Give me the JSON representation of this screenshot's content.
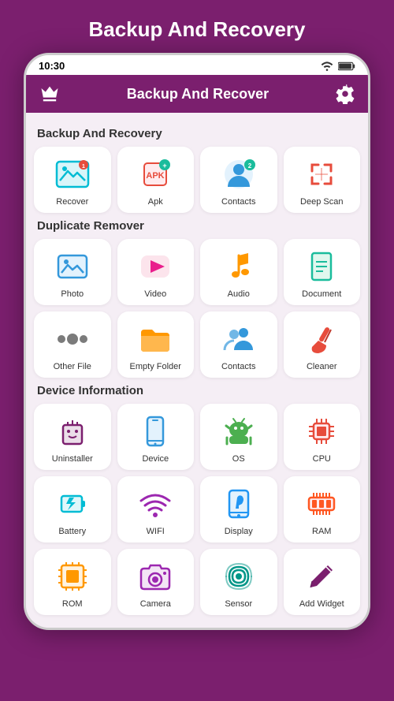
{
  "pageTitle": "Backup And Recovery",
  "statusBar": {
    "time": "10:30",
    "icons": [
      "wifi",
      "battery"
    ]
  },
  "header": {
    "title": "Backup And Recover",
    "leftIcon": "crown-icon",
    "rightIcon": "gear-icon"
  },
  "sections": [
    {
      "label": "Backup And Recovery",
      "items": [
        {
          "id": "recover",
          "label": "Recover",
          "color": "#00bcd4",
          "badge": "1",
          "badgeColor": "#e74c3c"
        },
        {
          "id": "apk",
          "label": "Apk",
          "color": "#e74c3c",
          "badge": "+",
          "badgeColor": "#1abc9c"
        },
        {
          "id": "contacts",
          "label": "Contacts",
          "color": "#3498db",
          "badge": "2",
          "badgeColor": "#1abc9c"
        },
        {
          "id": "deep-scan",
          "label": "Deep Scan",
          "color": "#e74c3c",
          "badge": null
        }
      ]
    },
    {
      "label": "Duplicate Remover",
      "items": [
        {
          "id": "photo",
          "label": "Photo",
          "color": "#3498db",
          "badge": null
        },
        {
          "id": "video",
          "label": "Video",
          "color": "#e91e8c",
          "badge": null
        },
        {
          "id": "audio",
          "label": "Audio",
          "color": "#ff9800",
          "badge": null
        },
        {
          "id": "document",
          "label": "Document",
          "color": "#1abc9c",
          "badge": null
        },
        {
          "id": "other-file",
          "label": "Other File",
          "color": "#7b7b7b",
          "badge": null
        },
        {
          "id": "empty-folder",
          "label": "Empty Folder",
          "color": "#ff9800",
          "badge": null
        },
        {
          "id": "contacts2",
          "label": "Contacts",
          "color": "#3498db",
          "badge": null
        },
        {
          "id": "cleaner",
          "label": "Cleaner",
          "color": "#e74c3c",
          "badge": null
        }
      ]
    },
    {
      "label": "Device Information",
      "items": [
        {
          "id": "uninstaller",
          "label": "Uninstaller",
          "color": "#7b1f6e",
          "badge": null
        },
        {
          "id": "device",
          "label": "Device",
          "color": "#3498db",
          "badge": null
        },
        {
          "id": "os",
          "label": "OS",
          "color": "#4caf50",
          "badge": null
        },
        {
          "id": "cpu",
          "label": "CPU",
          "color": "#e74c3c",
          "badge": null
        },
        {
          "id": "battery",
          "label": "Battery",
          "color": "#00bcd4",
          "badge": null
        },
        {
          "id": "wifi",
          "label": "WIFI",
          "color": "#9c27b0",
          "badge": null
        },
        {
          "id": "display",
          "label": "Display",
          "color": "#2196f3",
          "badge": null
        },
        {
          "id": "ram",
          "label": "RAM",
          "color": "#ff5722",
          "badge": null
        },
        {
          "id": "rom",
          "label": "ROM",
          "color": "#ff9800",
          "badge": null
        },
        {
          "id": "camera",
          "label": "Camera",
          "color": "#9c27b0",
          "badge": null
        },
        {
          "id": "sensor",
          "label": "Sensor",
          "color": "#009688",
          "badge": null
        },
        {
          "id": "add-widget",
          "label": "Add Widget",
          "color": "#7b1f6e",
          "badge": null
        }
      ]
    }
  ],
  "icons": {
    "recover": "🖼",
    "apk": "📦",
    "contacts": "👤",
    "deep-scan": "⊞",
    "photo": "🖼",
    "video": "▶",
    "audio": "♪",
    "document": "📄",
    "other-file": "⦿",
    "empty-folder": "📁",
    "contacts2": "👥",
    "cleaner": "🖌",
    "uninstaller": "🗑",
    "device": "📱",
    "os": "🤖",
    "cpu": "🔲",
    "battery": "🔋",
    "wifi": "📶",
    "display": "📲",
    "ram": "🔲",
    "rom": "⬛",
    "camera": "📷",
    "sensor": "📡",
    "add-widget": "✏"
  }
}
